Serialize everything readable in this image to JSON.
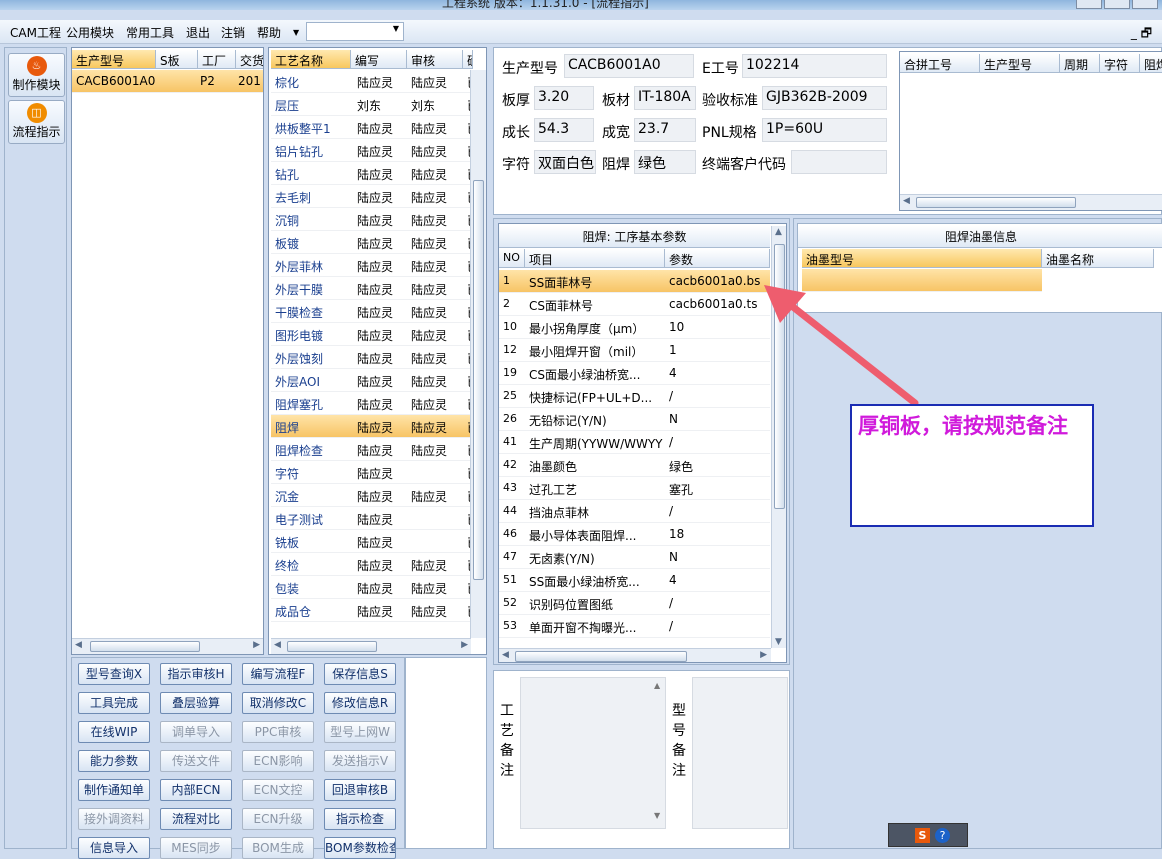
{
  "title": "工程系统   版本：1.1.31.0 - [流程指示]",
  "menu": {
    "items": [
      "CAM工程",
      "公用模块",
      "常用工具",
      "退出",
      "注销",
      "帮助"
    ],
    "combo": "",
    "mdi_controls": "_ 🗗"
  },
  "nav": {
    "items": [
      {
        "label": "制作模块",
        "icon": "flame-icon"
      },
      {
        "label": "流程指示",
        "icon": "process-icon"
      }
    ]
  },
  "product_grid": {
    "headers": [
      "生产型号",
      "S板",
      "工厂",
      "交货"
    ],
    "rows": [
      [
        "CACB6001A0",
        "",
        "P2",
        "201"
      ]
    ]
  },
  "process_grid": {
    "headers": [
      "工艺名称",
      "编写",
      "审核",
      "确"
    ],
    "rows": [
      [
        "棕化",
        "陆应灵",
        "陆应灵",
        "已"
      ],
      [
        "层压",
        "刘东",
        "刘东",
        "已"
      ],
      [
        "烘板整平1",
        "陆应灵",
        "陆应灵",
        "已"
      ],
      [
        "铝片钻孔",
        "陆应灵",
        "陆应灵",
        "已"
      ],
      [
        "钻孔",
        "陆应灵",
        "陆应灵",
        "已"
      ],
      [
        "去毛刺",
        "陆应灵",
        "陆应灵",
        "已"
      ],
      [
        "沉铜",
        "陆应灵",
        "陆应灵",
        "已"
      ],
      [
        "板镀",
        "陆应灵",
        "陆应灵",
        "已"
      ],
      [
        "外层菲林",
        "陆应灵",
        "陆应灵",
        "已"
      ],
      [
        "外层干膜",
        "陆应灵",
        "陆应灵",
        "已"
      ],
      [
        "干膜检查",
        "陆应灵",
        "陆应灵",
        "已"
      ],
      [
        "图形电镀",
        "陆应灵",
        "陆应灵",
        "已"
      ],
      [
        "外层蚀刻",
        "陆应灵",
        "陆应灵",
        "已"
      ],
      [
        "外层AOI",
        "陆应灵",
        "陆应灵",
        "已"
      ],
      [
        "阻焊塞孔",
        "陆应灵",
        "陆应灵",
        "已"
      ],
      [
        "阻焊",
        "陆应灵",
        "陆应灵",
        "已"
      ],
      [
        "阻焊检查",
        "陆应灵",
        "陆应灵",
        "已"
      ],
      [
        "字符",
        "陆应灵",
        "",
        "已"
      ],
      [
        "沉金",
        "陆应灵",
        "陆应灵",
        "已"
      ],
      [
        "电子测试",
        "陆应灵",
        "",
        "已"
      ],
      [
        "铣板",
        "陆应灵",
        "",
        "已"
      ],
      [
        "终检",
        "陆应灵",
        "陆应灵",
        "已"
      ],
      [
        "包装",
        "陆应灵",
        "陆应灵",
        "已"
      ],
      [
        "成品仓",
        "陆应灵",
        "陆应灵",
        "已"
      ]
    ],
    "selected": 15
  },
  "buttons": [
    [
      "型号查询X",
      "指示审核H",
      "编写流程F",
      "保存信息S"
    ],
    [
      "工具完成",
      "叠层验算",
      "取消修改C",
      "修改信息R"
    ],
    [
      "在线WIP",
      "调单导入",
      "PPC审核",
      "型号上网W"
    ],
    [
      "能力参数",
      "传送文件",
      "ECN影响",
      "发送指示V"
    ],
    [
      "制作通知单",
      "内部ECN",
      "ECN文控",
      "回退审核B"
    ],
    [
      "接外调资料",
      "流程对比",
      "ECN升级",
      "指示检查"
    ],
    [
      "信息导入",
      "MES同步",
      "BOM生成",
      "BOM参数检查"
    ]
  ],
  "disabled_buttons": [
    "调单导入",
    "PPC审核",
    "型号上网W",
    "传送文件",
    "ECN影响",
    "发送指示V",
    "ECN文控",
    "接外调资料",
    "ECN升级",
    "MES同步",
    "BOM生成"
  ],
  "info": {
    "model_label": "生产型号",
    "model": "CACB6001A0",
    "e_label": "E工号",
    "e_no": "102214",
    "thickness_label": "板厚",
    "thickness": "3.20",
    "material_label": "板材",
    "material": "IT-180A",
    "standard_label": "验收标准",
    "standard": "GJB362B-2009",
    "length_label": "成长",
    "length": "54.3",
    "width_label": "成宽",
    "width": "23.7",
    "pnl_label": "PNL规格",
    "pnl": "1P=60U",
    "char_label": "字符",
    "char": "双面白色",
    "mask_label": "阻焊",
    "mask": "绿色",
    "customer_label": "终端客户代码",
    "customer": ""
  },
  "merge_grid": {
    "headers": [
      "合拼工号",
      "生产型号",
      "周期",
      "字符",
      "阻焊"
    ]
  },
  "params": {
    "title": "阻焊: 工序基本参数",
    "headers": [
      "NO",
      "项目",
      "参数"
    ],
    "rows": [
      [
        "1",
        "SS面菲林号",
        "cacb6001a0.bs"
      ],
      [
        "2",
        "CS面菲林号",
        "cacb6001a0.ts"
      ],
      [
        "10",
        "最小拐角厚度（μm）",
        "10"
      ],
      [
        "12",
        "最小阻焊开窗（mil）",
        "1"
      ],
      [
        "19",
        "CS面最小绿油桥宽...",
        "4"
      ],
      [
        "25",
        "快捷标记(FP+UL+D...",
        "/"
      ],
      [
        "26",
        "无铅标记(Y/N)",
        "N"
      ],
      [
        "41",
        "生产周期(YYWW/WWYY)",
        "/"
      ],
      [
        "42",
        "油墨颜色",
        "绿色"
      ],
      [
        "43",
        "过孔工艺",
        "塞孔"
      ],
      [
        "44",
        "挡油点菲林",
        "/"
      ],
      [
        "46",
        "最小导体表面阻焊...",
        "18"
      ],
      [
        "47",
        "无卤素(Y/N)",
        "N"
      ],
      [
        "51",
        "SS面最小绿油桥宽...",
        "4"
      ],
      [
        "52",
        "识别码位置图纸",
        "/"
      ],
      [
        "53",
        "单面开窗不掏曝光...",
        "/"
      ],
      [
        "54",
        "生产周期位置(CS/SS)",
        "/"
      ]
    ]
  },
  "ink": {
    "title": "阻焊油墨信息",
    "headers": [
      "油墨型号",
      "油墨名称"
    ]
  },
  "remarks": {
    "process_label": "工艺备注",
    "model_label": "型号备注",
    "process_text": "",
    "model_text": ""
  },
  "annotation": {
    "text": "厚铜板，请按规范备注"
  }
}
